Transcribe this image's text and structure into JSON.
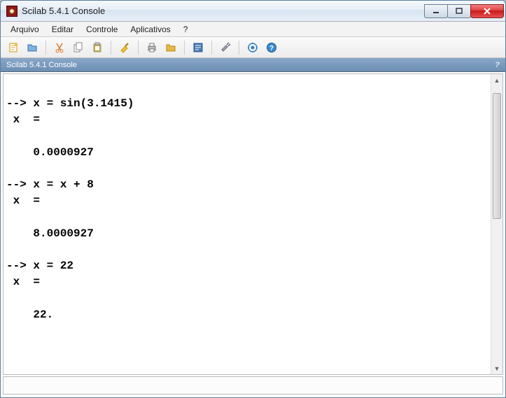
{
  "title": "Scilab 5.4.1 Console",
  "menu": {
    "items": [
      "Arquivo",
      "Editar",
      "Controle",
      "Aplicativos",
      "?"
    ]
  },
  "toolbar": {
    "icons": [
      {
        "name": "new-icon",
        "label": "new"
      },
      {
        "name": "open-icon",
        "label": "open"
      },
      {
        "sep": true
      },
      {
        "name": "cut-icon",
        "label": "cut"
      },
      {
        "name": "copy-icon",
        "label": "copy"
      },
      {
        "name": "paste-icon",
        "label": "paste"
      },
      {
        "sep": true
      },
      {
        "name": "clear-icon",
        "label": "clear"
      },
      {
        "sep": true
      },
      {
        "name": "print-icon",
        "label": "print"
      },
      {
        "name": "folder-icon",
        "label": "folder"
      },
      {
        "sep": true
      },
      {
        "name": "scinotes-icon",
        "label": "scinotes"
      },
      {
        "sep": true
      },
      {
        "name": "prefs-icon",
        "label": "prefs"
      },
      {
        "sep": true
      },
      {
        "name": "atoms-icon",
        "label": "atoms"
      },
      {
        "name": "help-icon",
        "label": "help"
      }
    ]
  },
  "panel": {
    "title": "Scilab 5.4.1 Console",
    "help": "?"
  },
  "console": {
    "lines": [
      "",
      "--> x = sin(3.1415)",
      " x  =",
      " ",
      "    0.0000927  ",
      " ",
      "--> x = x + 8",
      " x  =",
      " ",
      "    8.0000927  ",
      " ",
      "--> x = 22",
      " x  =",
      " ",
      "    22.  ",
      " "
    ]
  },
  "cmd_input": {
    "value": ""
  }
}
